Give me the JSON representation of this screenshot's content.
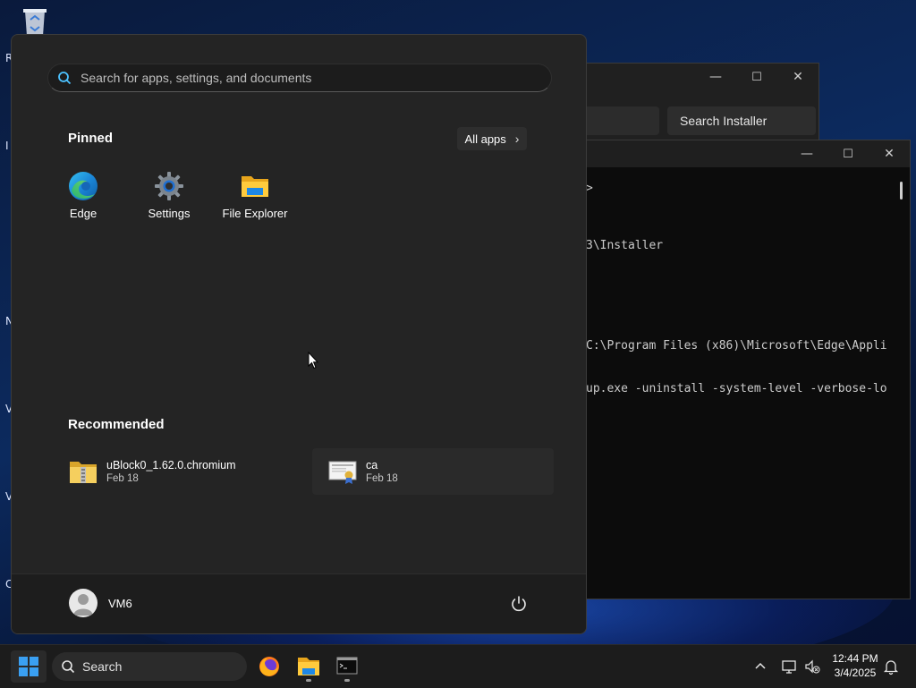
{
  "desktop": {
    "edge_letters": [
      "R",
      "I",
      "N",
      "V",
      "V",
      "C"
    ]
  },
  "installer_window": {
    "search_label": "Search Installer",
    "controls": {
      "minimize": "—",
      "maximize": "☐",
      "close": "✕"
    }
  },
  "console_window": {
    "controls": {
      "minimize": "—",
      "maximize": "☐",
      "close": "✕"
    },
    "lines": [
      {
        "text": ">"
      },
      {
        "text": "3\\Installer"
      },
      {
        "text": "C:\\Program Files (x86)\\Microsoft\\Edge\\Appli"
      },
      {
        "text": "up.exe -uninstall -system-level -verbose-lo"
      }
    ]
  },
  "start_menu": {
    "search_placeholder": "Search for apps, settings, and documents",
    "pinned_title": "Pinned",
    "all_apps_label": "All apps",
    "pinned_apps": [
      {
        "label": "Edge",
        "icon": "edge-icon"
      },
      {
        "label": "Settings",
        "icon": "gear-icon"
      },
      {
        "label": "File Explorer",
        "icon": "folder-icon"
      }
    ],
    "recommended_title": "Recommended",
    "recommended": [
      {
        "name": "uBlock0_1.62.0.chromium",
        "date": "Feb 18",
        "icon": "zip-folder-icon"
      },
      {
        "name": "ca",
        "date": "Feb 18",
        "icon": "certificate-icon"
      }
    ],
    "user_name": "VM6",
    "power_icon": "power-icon"
  },
  "taskbar": {
    "search_label": "Search",
    "apps": [
      "firefox-icon",
      "file-explorer-icon",
      "terminal-icon"
    ],
    "time": "12:44 PM",
    "date": "3/4/2025"
  },
  "colors": {
    "start_bg": "#242424",
    "accent": "#0078d4",
    "taskbar_bg": "#1c1c1c"
  }
}
